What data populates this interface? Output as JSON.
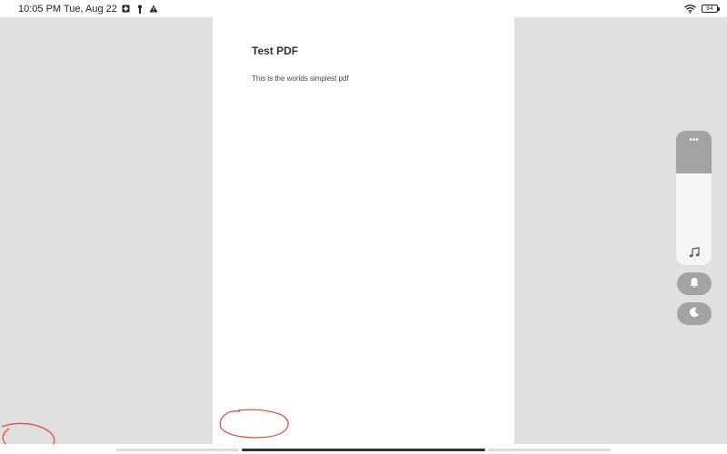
{
  "status_bar": {
    "time_date": "10:05 PM Tue, Aug 22",
    "icons": [
      "notification-badge-icon",
      "usb-icon",
      "warning-icon",
      "wifi-icon",
      "battery-icon"
    ],
    "battery_level": "94"
  },
  "pdf": {
    "title": "Test PDF",
    "body": "This is the worlds simplest pdf"
  },
  "volume_panel": {
    "more_label": "•••",
    "level_fraction": 0.68,
    "icons": [
      "music-note-icon",
      "bell-icon",
      "moon-icon"
    ]
  },
  "colors": {
    "viewer_background": "#e0e0e0",
    "page_background": "#ffffff",
    "panel_accent": "#a3a3a3",
    "annotation": "#e8452c"
  }
}
